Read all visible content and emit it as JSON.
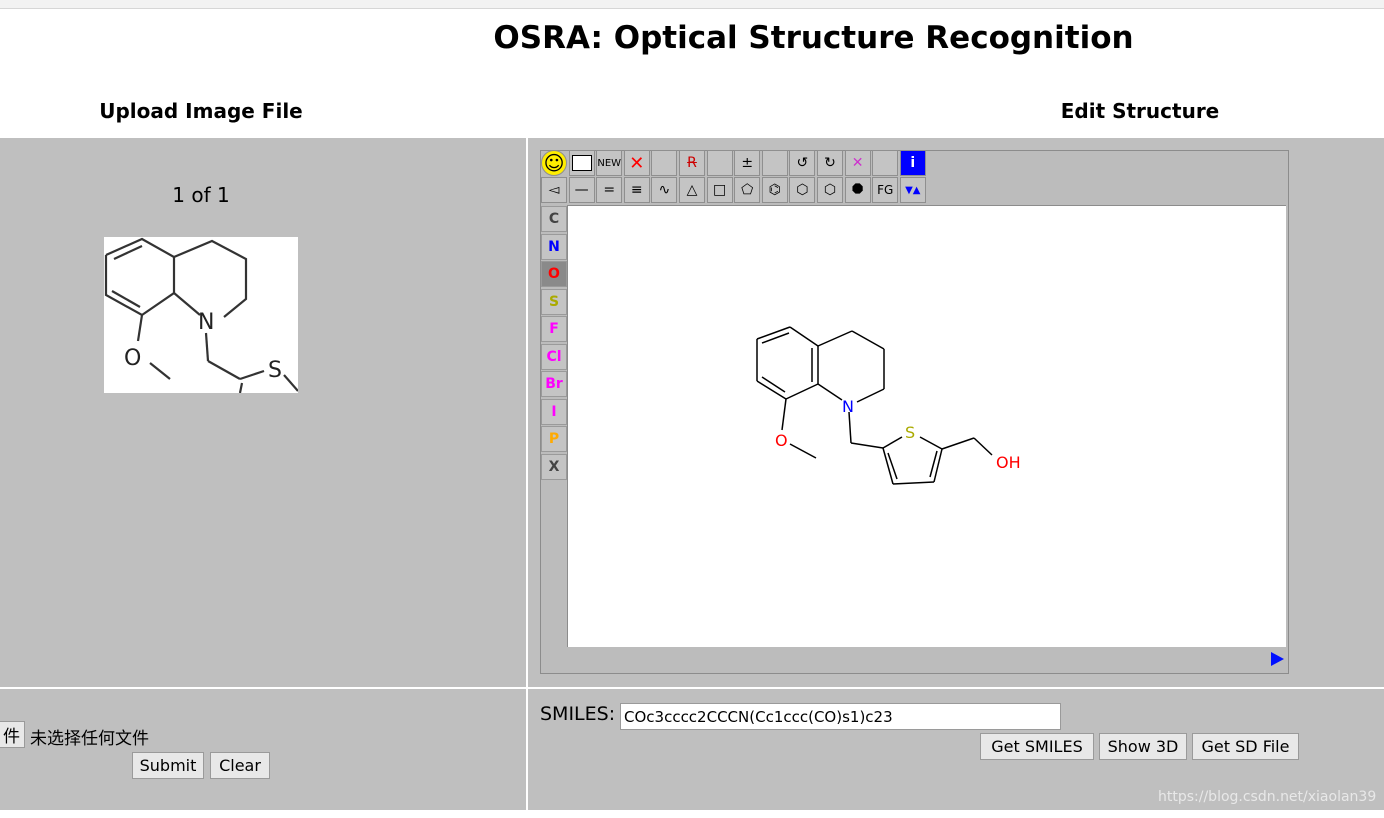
{
  "page": {
    "title": "OSRA: Optical Structure Recognition"
  },
  "left": {
    "heading": "Upload Image File",
    "page_counter": "1 of 1",
    "thumbnail_atoms": [
      "N",
      "O",
      "S"
    ],
    "file_button_label": "件",
    "file_status": "未选择任何文件",
    "submit_label": "Submit",
    "clear_label": "Clear"
  },
  "right": {
    "heading": "Edit Structure",
    "toolbar_row1": [
      {
        "name": "smiley-icon",
        "label": "☺"
      },
      {
        "name": "rectangle-select-icon",
        "label": ""
      },
      {
        "name": "new-button",
        "label": "NEW"
      },
      {
        "name": "delete-icon",
        "label": "✕"
      },
      {
        "name": "blank-tool-1",
        "label": ""
      },
      {
        "name": "remove-r-group-icon",
        "label": "R"
      },
      {
        "name": "blank-tool-2",
        "label": ""
      },
      {
        "name": "charge-icon",
        "label": "±"
      },
      {
        "name": "blank-tool-3",
        "label": ""
      },
      {
        "name": "undo-icon",
        "label": "↺"
      },
      {
        "name": "redo-icon",
        "label": "↻"
      },
      {
        "name": "clear-icon",
        "label": "✕"
      },
      {
        "name": "blank-tool-4",
        "label": ""
      },
      {
        "name": "info-icon",
        "label": "i"
      }
    ],
    "toolbar_row2": [
      {
        "name": "wedge-bond-icon",
        "label": "◅"
      },
      {
        "name": "single-bond-icon",
        "label": "—"
      },
      {
        "name": "double-bond-icon",
        "label": "="
      },
      {
        "name": "triple-bond-icon",
        "label": "≡"
      },
      {
        "name": "chain-icon",
        "label": "∿"
      },
      {
        "name": "triangle-ring-icon",
        "label": "△"
      },
      {
        "name": "square-ring-icon",
        "label": "□"
      },
      {
        "name": "pentagon-ring-icon",
        "label": "⬠"
      },
      {
        "name": "benzene-ring-icon",
        "label": "⌬"
      },
      {
        "name": "hexagon-ring-icon",
        "label": "⬡"
      },
      {
        "name": "heptagon-ring-icon",
        "label": "⬡"
      },
      {
        "name": "octagon-ring-icon",
        "label": "⯃"
      },
      {
        "name": "functional-group-button",
        "label": "FG"
      },
      {
        "name": "query-icon",
        "label": "▼▲"
      }
    ],
    "elements": [
      {
        "label": "C",
        "color": "#444444"
      },
      {
        "label": "N",
        "color": "#0000ff"
      },
      {
        "label": "O",
        "color": "#ff0000"
      },
      {
        "label": "S",
        "color": "#aaaa00"
      },
      {
        "label": "F",
        "color": "#ff00ff"
      },
      {
        "label": "Cl",
        "color": "#ff00ff"
      },
      {
        "label": "Br",
        "color": "#ff00ff"
      },
      {
        "label": "I",
        "color": "#ff00ff"
      },
      {
        "label": "P",
        "color": "#ffaa00"
      },
      {
        "label": "X",
        "color": "#444444"
      }
    ],
    "molecule_atoms": {
      "n": "N",
      "o": "O",
      "s": "S",
      "oh": "OH"
    },
    "smiles_label": "SMILES:",
    "smiles_value": "COc3cccc2CCCN(Cc1ccc(CO)s1)c23",
    "get_smiles_label": "Get SMILES",
    "show_3d_label": "Show 3D",
    "get_sd_label": "Get SD File"
  },
  "watermark": "https://blog.csdn.net/xiaolan39",
  "colors": {
    "panel": "#bfbfbf",
    "nitrogen": "#0000ff",
    "oxygen": "#ff0000",
    "sulfur": "#aaaa00"
  }
}
